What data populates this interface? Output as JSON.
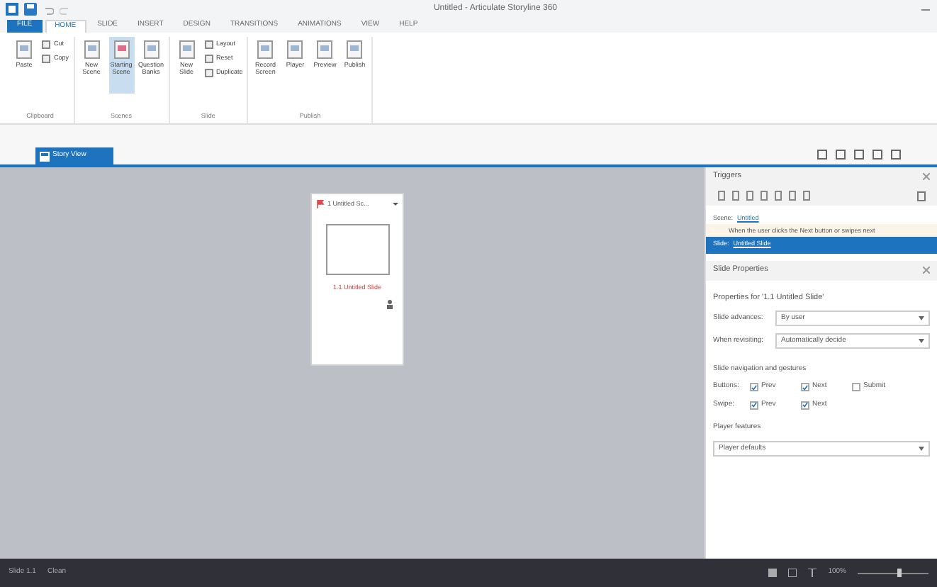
{
  "window": {
    "title": "Untitled - Articulate Storyline 360"
  },
  "menu_tabs": [
    {
      "label": "FILE",
      "selected": false,
      "kind": "file"
    },
    {
      "label": "HOME",
      "selected": true,
      "kind": "tab"
    },
    {
      "label": "SLIDE",
      "selected": false,
      "kind": "tab"
    },
    {
      "label": "INSERT",
      "selected": false,
      "kind": "tab"
    },
    {
      "label": "DESIGN",
      "selected": false,
      "kind": "tab"
    },
    {
      "label": "TRANSITIONS",
      "selected": false,
      "kind": "tab"
    },
    {
      "label": "ANIMATIONS",
      "selected": false,
      "kind": "tab"
    },
    {
      "label": "VIEW",
      "selected": false,
      "kind": "tab"
    },
    {
      "label": "HELP",
      "selected": false,
      "kind": "tab"
    }
  ],
  "ribbon_groups": [
    {
      "name": "Clipboard",
      "items": [
        {
          "label": "Paste",
          "kind": "large",
          "selected": false
        },
        {
          "label": "Cut",
          "kind": "small",
          "selected": false
        },
        {
          "label": "Copy",
          "kind": "small",
          "selected": false
        }
      ]
    },
    {
      "name": "Scenes",
      "items": [
        {
          "label": "New Scene",
          "kind": "large",
          "selected": false
        },
        {
          "label": "Starting Scene",
          "kind": "large",
          "selected": true
        },
        {
          "label": "Question Banks",
          "kind": "large",
          "selected": false
        }
      ]
    },
    {
      "name": "Slide",
      "items": [
        {
          "label": "New Slide",
          "kind": "large",
          "selected": false
        },
        {
          "label": "Layout",
          "kind": "small",
          "selected": false
        },
        {
          "label": "Reset",
          "kind": "small",
          "selected": false
        },
        {
          "label": "Duplicate",
          "kind": "small",
          "selected": false
        }
      ]
    },
    {
      "name": "Publish",
      "items": [
        {
          "label": "Record Screen",
          "kind": "large",
          "selected": false
        },
        {
          "label": "Player",
          "kind": "large",
          "selected": false
        },
        {
          "label": "Preview",
          "kind": "large",
          "selected": false
        },
        {
          "label": "Publish",
          "kind": "large",
          "selected": false
        }
      ]
    }
  ],
  "document_tab": {
    "label": "Story View"
  },
  "scene": {
    "title": "1 Untitled Sc...",
    "slide_label": "1.1 Untitled Slide"
  },
  "triggers": {
    "title": "Triggers",
    "scene_label": "Scene:",
    "scene_name": "Untitled",
    "trigger_text": "When the user clicks the Next button or swipes next",
    "slide_label": "Slide:",
    "slide_name": "Untitled Slide"
  },
  "properties": {
    "title": "Slide Properties",
    "heading": "Properties for '1.1 Untitled Slide'",
    "fields": [
      {
        "label": "Slide advances:",
        "value": "By user"
      },
      {
        "label": "When revisiting:",
        "value": "Automatically decide"
      }
    ],
    "nav_heading": "Slide navigation and gestures",
    "nav_rows": [
      {
        "label": "Buttons:",
        "options": [
          {
            "label": "Prev",
            "checked": true
          },
          {
            "label": "Next",
            "checked": true
          },
          {
            "label": "Submit",
            "checked": false
          }
        ]
      },
      {
        "label": "Swipe:",
        "options": [
          {
            "label": "Prev",
            "checked": true
          },
          {
            "label": "Next",
            "checked": true
          }
        ]
      }
    ],
    "player_heading": "Player features",
    "player_value": "Player defaults"
  },
  "status_bar": {
    "slide": "Slide 1.1",
    "state": "Clean",
    "zoom": "100%",
    "zoom_slider": {
      "level": 0.6
    }
  }
}
